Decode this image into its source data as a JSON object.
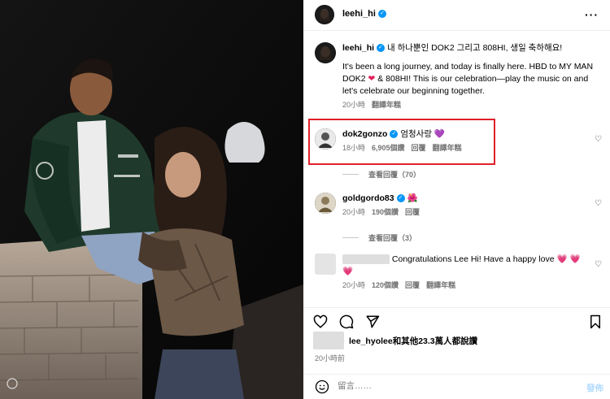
{
  "header": {
    "username": "leehi_hi",
    "verified_mark": "✓",
    "more_label": "···"
  },
  "caption": {
    "username": "leehi_hi",
    "text_line1": "내 하나뿐인 DOK2 그리고 808HI, 생일 축하해요!",
    "text_line2": "It's been a long journey, and today is finally here. HBD to MY MAN DOK2",
    "text_line2b": "& 808HI! This is our celebration—play the music on and let's celebrate our beginning together.",
    "time": "20小時",
    "see_translation": "翻譯年糕"
  },
  "comments": [
    {
      "username": "dok2gonzo",
      "text": "엄청사랑",
      "time": "18小時",
      "likes": "6,905個讚",
      "reply": "回覆",
      "translate": "翻譯年糕",
      "view_replies": "查看回覆（70）"
    },
    {
      "username": "goldgordo83",
      "text": "",
      "time": "20小時",
      "likes": "190個讚",
      "reply": "回覆",
      "view_replies": "查看回覆（3）"
    },
    {
      "username": "",
      "text": "Congratulations Lee Hi! Have a happy love",
      "time": "20小時",
      "likes": "120個讚",
      "reply": "回覆",
      "translate": "翻譯年糕"
    }
  ],
  "likes_text": "lee_hyolee和其他23.3萬人都說讚",
  "post_time": "20小時前",
  "composer": {
    "placeholder": "留言……",
    "post_label": "發佈"
  },
  "icons": [
    "heart-icon",
    "comment-icon",
    "share-icon",
    "bookmark-icon",
    "emoji-icon",
    "verified-icon",
    "more-icon"
  ],
  "colors": {
    "verified": "#0095f6",
    "highlight": "#e0202a",
    "post_disabled": "#b3dbff",
    "muted": "#737373"
  }
}
